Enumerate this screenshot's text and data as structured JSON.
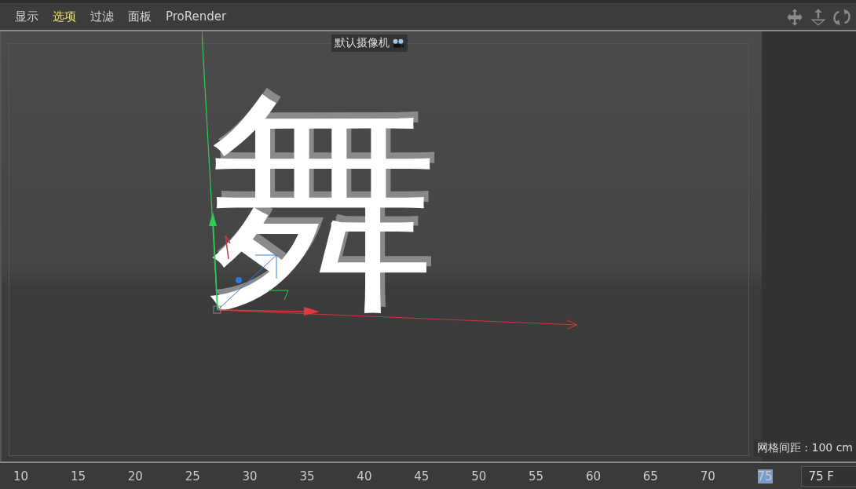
{
  "menu": [
    {
      "label": "显示",
      "selected": false
    },
    {
      "label": "选项",
      "selected": true
    },
    {
      "label": "过滤",
      "selected": false
    },
    {
      "label": "面板",
      "selected": false
    },
    {
      "label": "ProRender",
      "selected": false
    }
  ],
  "viewport": {
    "camera_label": "默认摄像机",
    "object_text": "舞",
    "grid_spacing": "网格间距 : 100 cm"
  },
  "timeline": {
    "ticks": [
      {
        "label": "10",
        "selected": false
      },
      {
        "label": "15",
        "selected": false
      },
      {
        "label": "20",
        "selected": false
      },
      {
        "label": "25",
        "selected": false
      },
      {
        "label": "30",
        "selected": false
      },
      {
        "label": "35",
        "selected": false
      },
      {
        "label": "40",
        "selected": false
      },
      {
        "label": "45",
        "selected": false
      },
      {
        "label": "50",
        "selected": false
      },
      {
        "label": "55",
        "selected": false
      },
      {
        "label": "60",
        "selected": false
      },
      {
        "label": "65",
        "selected": false
      },
      {
        "label": "70",
        "selected": false
      },
      {
        "label": "75",
        "selected": true
      }
    ],
    "frame_field": "75 F"
  }
}
